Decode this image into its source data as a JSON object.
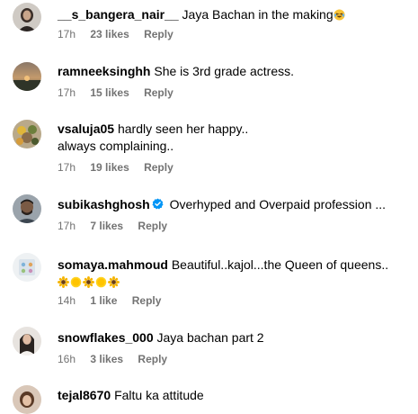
{
  "comments": [
    {
      "username": "__s_bangera_nair__",
      "text": "Jaya Bachan in the making",
      "emoji": "laughing-crying-face",
      "time": "17h",
      "likes": "23 likes",
      "reply": "Reply"
    },
    {
      "username": "ramneeksinghh",
      "text": "She is 3rd grade actress.",
      "time": "17h",
      "likes": "15 likes",
      "reply": "Reply"
    },
    {
      "username": "vsaluja05",
      "text": "hardly seen her happy..",
      "text2": "always complaining..",
      "time": "17h",
      "likes": "19 likes",
      "reply": "Reply"
    },
    {
      "username": "subikashghosh",
      "verified": true,
      "text": "Overhyped and Overpaid profession ...",
      "time": "17h",
      "likes": "7 likes",
      "reply": "Reply"
    },
    {
      "username": "somaya.mahmoud",
      "text": "Beautiful..kajol...the Queen of queens..",
      "emoji_row": [
        "sunflower",
        "sun",
        "sunflower",
        "sun",
        "sunflower"
      ],
      "time": "14h",
      "likes": "1 like",
      "reply": "Reply"
    },
    {
      "username": "snowflakes_000",
      "text": "Jaya bachan part 2",
      "time": "16h",
      "likes": "3 likes",
      "reply": "Reply"
    },
    {
      "username": "tejal8670",
      "text": "Faltu ka attitude"
    }
  ],
  "colors": {
    "meta_text": "#737373",
    "verified_badge": "#0095f6"
  }
}
